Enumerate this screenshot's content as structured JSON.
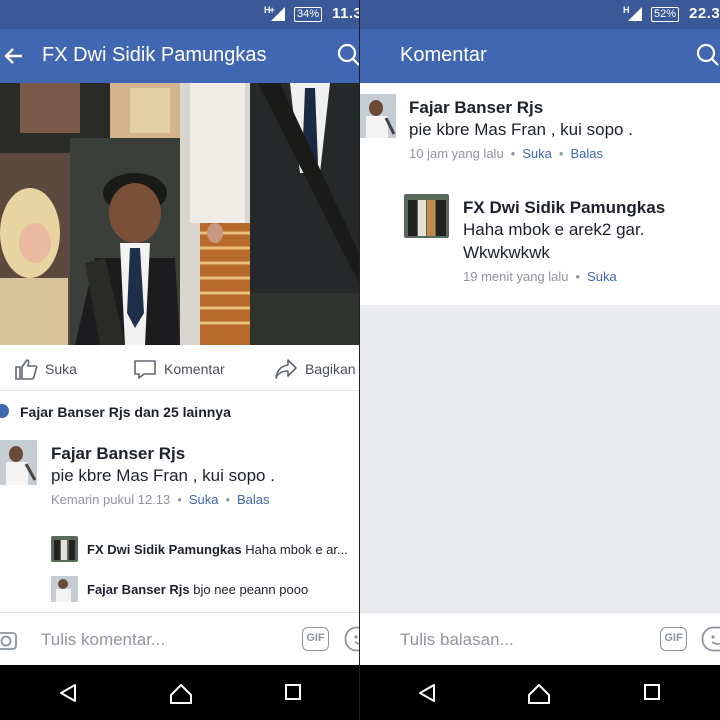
{
  "left": {
    "status": {
      "network": "H+",
      "battery": "34%",
      "time": "11.3"
    },
    "appbar": {
      "title": "FX Dwi Sidik Pamungkas"
    },
    "actions": {
      "like": "Suka",
      "comment": "Komentar",
      "share": "Bagikan"
    },
    "likes": {
      "text": "Fajar Banser Rjs dan 25 lainnya"
    },
    "comment": {
      "author": "Fajar Banser Rjs",
      "text": "pie kbre Mas Fran , kui sopo .",
      "time": "Kemarin pukul 12.13",
      "like": "Suka",
      "reply": "Balas",
      "separator": "•"
    },
    "replies": [
      {
        "author": "FX Dwi Sidik Pamungkas",
        "text": "Haha mbok e ar..."
      },
      {
        "author": "Fajar Banser Rjs",
        "text": "bjo nee peann pooo"
      }
    ],
    "input": {
      "placeholder": "Tulis komentar...",
      "gif": "GIF"
    }
  },
  "right": {
    "status": {
      "network": "H",
      "battery": "52%",
      "time": "22.3"
    },
    "appbar": {
      "title": "Komentar"
    },
    "comment": {
      "author": "Fajar Banser Rjs",
      "text": "pie kbre Mas Fran , kui sopo .",
      "time": "10 jam yang lalu",
      "like": "Suka",
      "reply": "Balas",
      "separator": "•"
    },
    "reply": {
      "author": "FX Dwi Sidik Pamungkas",
      "line1": "Haha mbok e arek2 gar.",
      "line2": "Wkwkwkwk",
      "time": "19 menit yang lalu",
      "like": "Suka",
      "separator": "•"
    },
    "input": {
      "placeholder": "Tulis balasan...",
      "gif": "GIF"
    }
  },
  "colors": {
    "status_bar": "#3b5998",
    "app_bar": "#4267b2",
    "link": "#4267b2",
    "meta": "#90949c",
    "background_gray": "#e9ebee"
  }
}
